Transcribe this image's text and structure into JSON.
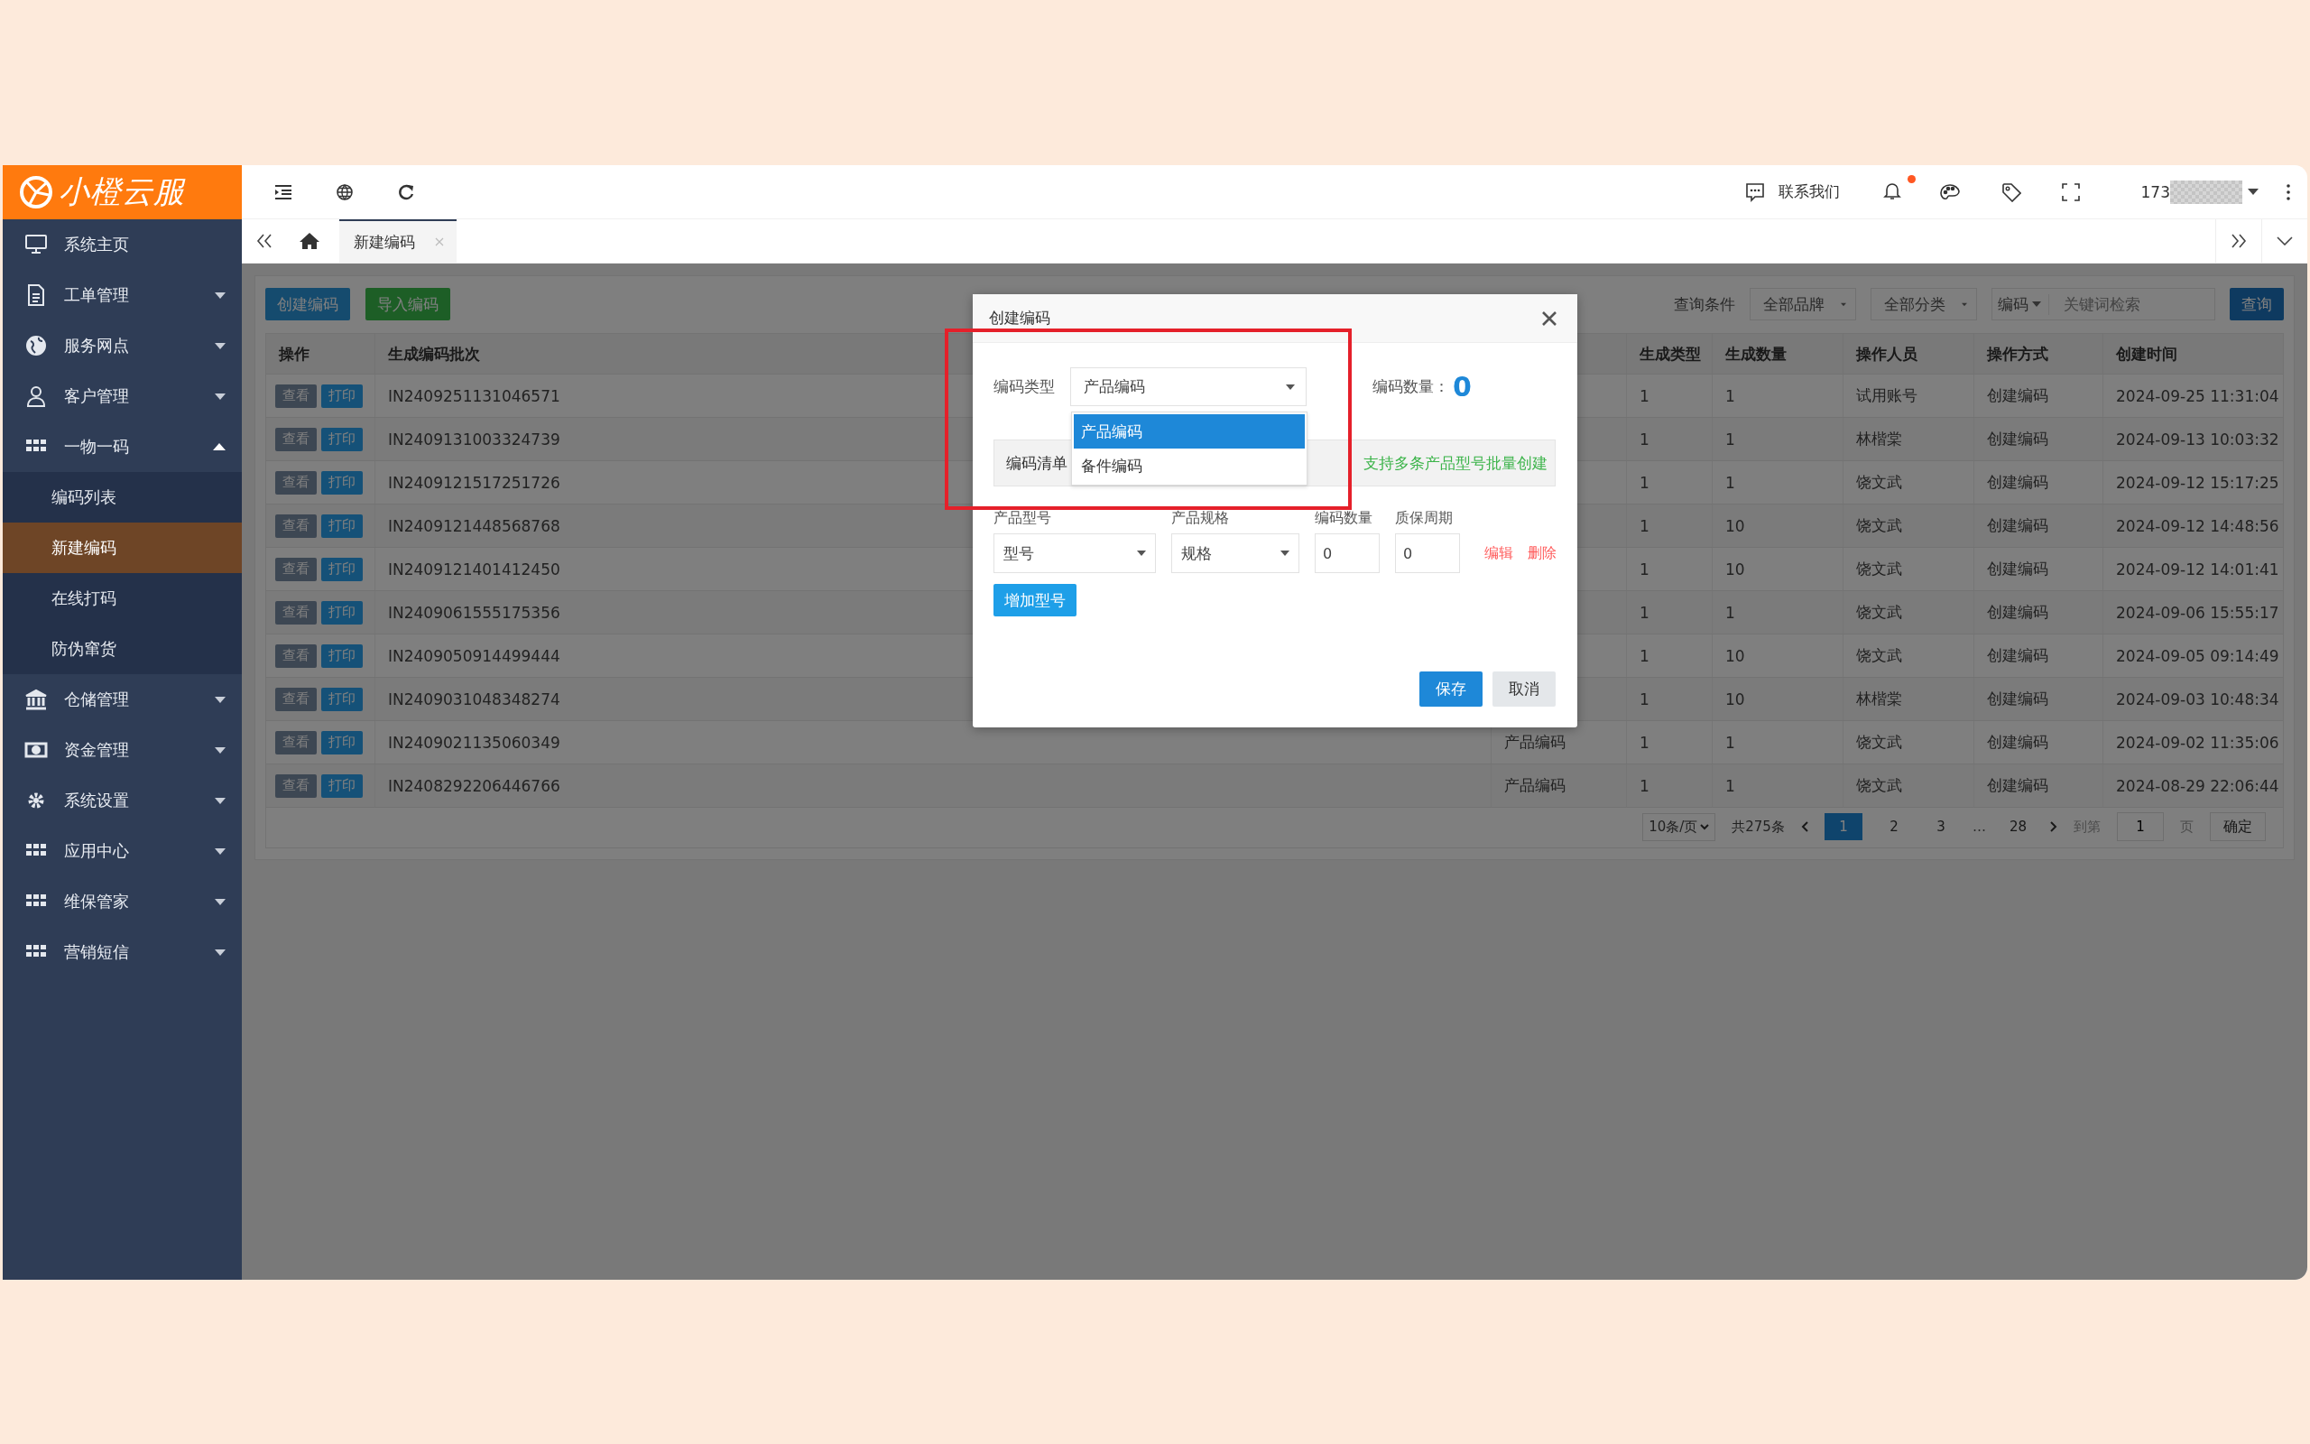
{
  "sidebar": {
    "logo": "小橙云服",
    "items": [
      {
        "label": "系统主页",
        "kind": "link"
      },
      {
        "label": "工单管理",
        "kind": "group",
        "expanded": false
      },
      {
        "label": "服务网点",
        "kind": "group",
        "expanded": false
      },
      {
        "label": "客户管理",
        "kind": "group",
        "expanded": false
      },
      {
        "label": "一物一码",
        "kind": "group",
        "expanded": true,
        "children": [
          {
            "label": "编码列表",
            "selected": false
          },
          {
            "label": "新建编码",
            "selected": true
          },
          {
            "label": "在线打码",
            "selected": false
          },
          {
            "label": "防伪窜货",
            "selected": false
          }
        ]
      },
      {
        "label": "仓储管理",
        "kind": "group",
        "expanded": false
      },
      {
        "label": "资金管理",
        "kind": "group",
        "expanded": false
      },
      {
        "label": "系统设置",
        "kind": "group",
        "expanded": false
      },
      {
        "label": "应用中心",
        "kind": "group",
        "expanded": false
      },
      {
        "label": "维保管家",
        "kind": "group",
        "expanded": false
      },
      {
        "label": "营销短信",
        "kind": "group",
        "expanded": false
      }
    ]
  },
  "header": {
    "contact": "联系我们",
    "unread": true,
    "user": "173"
  },
  "tabs": [
    {
      "label": "新建编码",
      "selected": true
    }
  ],
  "toolbar": {
    "buttons": [
      {
        "label": "创建编码",
        "kind": "primary"
      },
      {
        "label": "导入编码",
        "kind": "success"
      }
    ],
    "filter_label": "查询条件",
    "selects": [
      "全部品牌",
      "全部分类"
    ],
    "search_scope": "编码",
    "search_placeholder": "关键词检索",
    "search_button": "查询"
  },
  "table": {
    "columns": [
      "操作",
      "生成编码批次",
      "生成类型",
      "生成数量",
      "操作人员",
      "操作方式",
      "创建时间"
    ],
    "rows": [
      {
        "actions": [
          "查看",
          "打印"
        ],
        "batch": "IN2409251131046571",
        "gen_type": "1",
        "quantity": "1",
        "operator": "试用账号",
        "method": "创建编码",
        "created": "2024-09-25 11:31:04"
      },
      {
        "actions": [
          "查看",
          "打印"
        ],
        "batch": "IN2409131003324739",
        "gen_type": "1",
        "quantity": "1",
        "operator": "林楷棠",
        "method": "创建编码",
        "created": "2024-09-13 10:03:32"
      },
      {
        "actions": [
          "查看",
          "打印"
        ],
        "batch": "IN2409121517251726",
        "gen_type": "1",
        "quantity": "1",
        "operator": "饶文武",
        "method": "创建编码",
        "created": "2024-09-12 15:17:25"
      },
      {
        "actions": [
          "查看",
          "打印"
        ],
        "batch": "IN2409121448568768",
        "gen_type": "1",
        "quantity": "10",
        "operator": "饶文武",
        "method": "创建编码",
        "created": "2024-09-12 14:48:56"
      },
      {
        "actions": [
          "查看",
          "打印"
        ],
        "batch": "IN2409121401412450",
        "gen_type": "1",
        "quantity": "10",
        "operator": "饶文武",
        "method": "创建编码",
        "created": "2024-09-12 14:01:41"
      },
      {
        "actions": [
          "查看",
          "打印"
        ],
        "batch": "IN2409061555175356",
        "gen_type": "1",
        "quantity": "1",
        "operator": "饶文武",
        "method": "创建编码",
        "created": "2024-09-06 15:55:17"
      },
      {
        "actions": [
          "查看",
          "打印"
        ],
        "batch": "IN2409050914499444",
        "gen_type": "1",
        "quantity": "10",
        "operator": "饶文武",
        "method": "创建编码",
        "created": "2024-09-05 09:14:49"
      },
      {
        "actions": [
          "查看",
          "打印"
        ],
        "batch": "IN2409031048348274",
        "gen_type": "1",
        "quantity": "10",
        "operator": "林楷棠",
        "method": "创建编码",
        "created": "2024-09-03 10:48:34"
      },
      {
        "actions": [
          "查看",
          "打印"
        ],
        "batch": "IN2409021135060349",
        "column_3": "产品编码",
        "gen_type": "1",
        "quantity": "1",
        "operator": "饶文武",
        "method": "创建编码",
        "created": "2024-09-02 11:35:06"
      },
      {
        "actions": [
          "查看",
          "打印"
        ],
        "batch": "IN2408292206446766",
        "column_3": "产品编码",
        "gen_type": "1",
        "quantity": "1",
        "operator": "饶文武",
        "method": "创建编码",
        "created": "2024-08-29 22:06:44"
      }
    ]
  },
  "pagination": {
    "page_size": "10条/页",
    "total": "共275条",
    "pages": [
      {
        "label": "1",
        "kind": "page",
        "selected": true
      },
      {
        "label": "2",
        "kind": "page",
        "selected": false
      },
      {
        "label": "3",
        "kind": "page",
        "selected": false
      },
      {
        "label": "…",
        "kind": "gap"
      },
      {
        "label": "28",
        "kind": "page",
        "selected": false
      }
    ],
    "goto_label": "到第",
    "goto_value": "1",
    "goto_unit": "页",
    "goto_button": "确定"
  },
  "modal": {
    "title": "创建编码",
    "type_label": "编码类型",
    "type_value": "产品编码",
    "type_options": [
      {
        "label": "产品编码",
        "selected": true
      },
      {
        "label": "备件编码",
        "selected": false
      }
    ],
    "count_label": "编码数量：",
    "count_value": "0",
    "section_title": "编码清单",
    "section_hint": "支持多条产品型号批量创建",
    "columns": [
      "产品型号",
      "产品规格",
      "编码数量",
      "质保周期"
    ],
    "items": [
      {
        "model": "型号",
        "spec": "规格",
        "quantity": "0",
        "warranty": "0",
        "actions": [
          "编辑",
          "删除"
        ]
      }
    ],
    "add_button": "增加型号",
    "buttons": [
      {
        "label": "保存",
        "kind": "primary"
      },
      {
        "label": "取消",
        "kind": "secondary"
      }
    ]
  }
}
